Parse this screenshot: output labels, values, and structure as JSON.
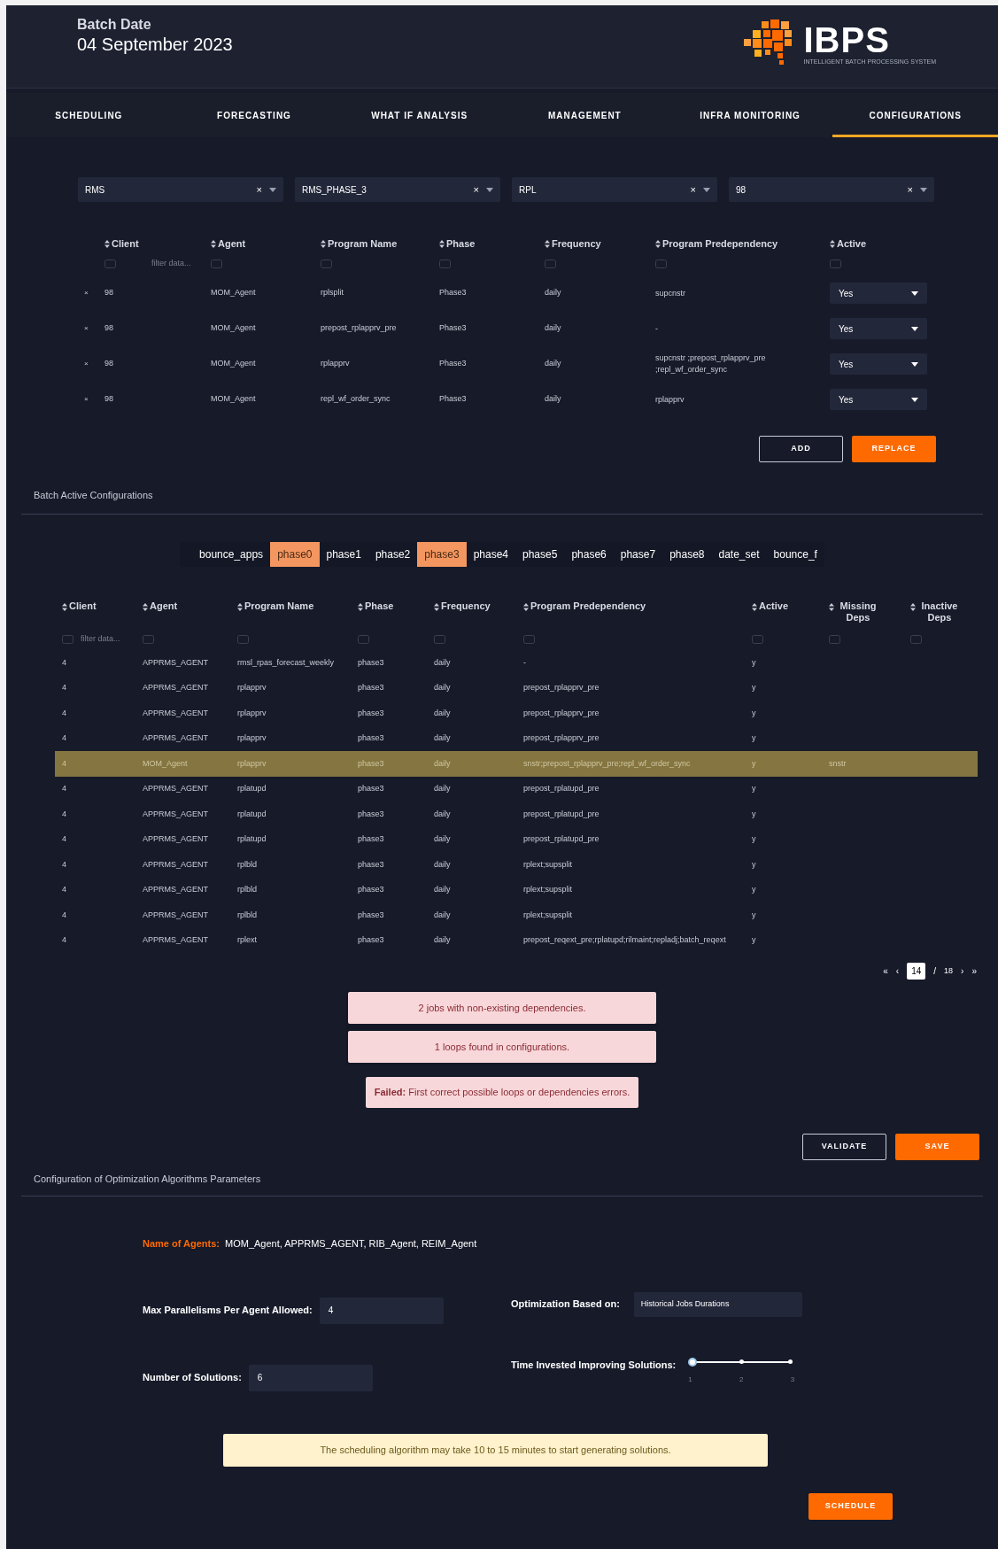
{
  "header": {
    "label": "Batch Date",
    "date": "04 September 2023",
    "logo": {
      "name": "IBPS",
      "tagline": "INTELLIGENT BATCH PROCESSING SYSTEM"
    }
  },
  "tabs": [
    {
      "label": "SCHEDULING",
      "selected": false
    },
    {
      "label": "FORECASTING",
      "selected": false
    },
    {
      "label": "WHAT IF ANALYSIS",
      "selected": false
    },
    {
      "label": "MANAGEMENT",
      "selected": false
    },
    {
      "label": "INFRA MONITORING",
      "selected": false
    },
    {
      "label": "CONFIGURATIONS",
      "selected": true
    }
  ],
  "filters": [
    {
      "value": "RMS",
      "clear": "×"
    },
    {
      "value": "RMS_PHASE_3",
      "clear": "×"
    },
    {
      "value": "RPL",
      "clear": "×"
    },
    {
      "value": "98",
      "clear": "×"
    }
  ],
  "config_table": {
    "columns": [
      "Client",
      "Agent",
      "Program Name",
      "Phase",
      "Frequency",
      "Program Predependency",
      "Active"
    ],
    "filter_placeholder": "filter data...",
    "rows": [
      {
        "remove": "×",
        "cells": [
          "98",
          "MOM_Agent",
          "rplsplit",
          "Phase3",
          "daily",
          "supcnstr"
        ],
        "active": "Yes"
      },
      {
        "remove": "×",
        "cells": [
          "98",
          "MOM_Agent",
          "prepost_rplapprv_pre",
          "Phase3",
          "daily",
          "-"
        ],
        "active": "Yes"
      },
      {
        "remove": "×",
        "cells": [
          "98",
          "MOM_Agent",
          "rplapprv",
          "Phase3",
          "daily",
          "supcnstr ;prepost_rplapprv_pre ;repl_wf_order_sync"
        ],
        "active": "Yes"
      },
      {
        "remove": "×",
        "cells": [
          "98",
          "MOM_Agent",
          "repl_wf_order_sync",
          "Phase3",
          "daily",
          "rplapprv"
        ],
        "active": "Yes"
      }
    ]
  },
  "config_buttons": [
    {
      "label": "ADD",
      "kind": "outline"
    },
    {
      "label": "REPLACE",
      "kind": "primary"
    }
  ],
  "batch_section": {
    "title": "Batch Active Configurations",
    "phases": [
      {
        "label": "bounce_apps",
        "selected": false
      },
      {
        "label": "phase0",
        "selected": true
      },
      {
        "label": "phase1",
        "selected": false
      },
      {
        "label": "phase2",
        "selected": false
      },
      {
        "label": "phase3",
        "selected": true
      },
      {
        "label": "phase4",
        "selected": false
      },
      {
        "label": "phase5",
        "selected": false
      },
      {
        "label": "phase6",
        "selected": false
      },
      {
        "label": "phase7",
        "selected": false
      },
      {
        "label": "phase8",
        "selected": false
      },
      {
        "label": "date_set",
        "selected": false
      },
      {
        "label": "bounce_f",
        "selected": false
      }
    ],
    "table": {
      "columns": [
        "Client",
        "Agent",
        "Program Name",
        "Phase",
        "Frequency",
        "Program Predependency",
        "Active",
        "Missing Deps",
        "Inactive Deps"
      ],
      "filter_placeholder": "filter data...",
      "rows": [
        {
          "highlighted": false,
          "cells": [
            "4",
            "APPRMS_AGENT",
            "rmsl_rpas_forecast_weekly",
            "phase3",
            "daily",
            "-",
            "y",
            "",
            ""
          ]
        },
        {
          "highlighted": false,
          "cells": [
            "4",
            "APPRMS_AGENT",
            "rplapprv",
            "phase3",
            "daily",
            "prepost_rplapprv_pre",
            "y",
            "",
            ""
          ]
        },
        {
          "highlighted": false,
          "cells": [
            "4",
            "APPRMS_AGENT",
            "rplapprv",
            "phase3",
            "daily",
            "prepost_rplapprv_pre",
            "y",
            "",
            ""
          ]
        },
        {
          "highlighted": false,
          "cells": [
            "4",
            "APPRMS_AGENT",
            "rplapprv",
            "phase3",
            "daily",
            "prepost_rplapprv_pre",
            "y",
            "",
            ""
          ]
        },
        {
          "highlighted": true,
          "cells": [
            "4",
            "MOM_Agent",
            "rplapprv",
            "phase3",
            "daily",
            "snstr;prepost_rplapprv_pre;repl_wf_order_sync",
            "y",
            "snstr",
            ""
          ]
        },
        {
          "highlighted": false,
          "cells": [
            "4",
            "APPRMS_AGENT",
            "rplatupd",
            "phase3",
            "daily",
            "prepost_rplatupd_pre",
            "y",
            "",
            ""
          ]
        },
        {
          "highlighted": false,
          "cells": [
            "4",
            "APPRMS_AGENT",
            "rplatupd",
            "phase3",
            "daily",
            "prepost_rplatupd_pre",
            "y",
            "",
            ""
          ]
        },
        {
          "highlighted": false,
          "cells": [
            "4",
            "APPRMS_AGENT",
            "rplatupd",
            "phase3",
            "daily",
            "prepost_rplatupd_pre",
            "y",
            "",
            ""
          ]
        },
        {
          "highlighted": false,
          "cells": [
            "4",
            "APPRMS_AGENT",
            "rplbld",
            "phase3",
            "daily",
            "rplext;supsplit",
            "y",
            "",
            ""
          ]
        },
        {
          "highlighted": false,
          "cells": [
            "4",
            "APPRMS_AGENT",
            "rplbld",
            "phase3",
            "daily",
            "rplext;supsplit",
            "y",
            "",
            ""
          ]
        },
        {
          "highlighted": false,
          "cells": [
            "4",
            "APPRMS_AGENT",
            "rplbld",
            "phase3",
            "daily",
            "rplext;supsplit",
            "y",
            "",
            ""
          ]
        },
        {
          "highlighted": false,
          "cells": [
            "4",
            "APPRMS_AGENT",
            "rplext",
            "phase3",
            "daily",
            "prepost_reqext_pre;rplatupd;rilmaint;repladj;batch_reqext",
            "y",
            "",
            ""
          ]
        }
      ]
    },
    "pagination": {
      "first": "«",
      "prev": "‹",
      "page": "14",
      "separator": "/",
      "total": "18",
      "next": "›",
      "last": "»"
    },
    "alerts": [
      {
        "kind": "error",
        "text": "2 jobs with non-existing dependencies."
      },
      {
        "kind": "error",
        "text": "1 loops found in configurations."
      }
    ],
    "result": {
      "kind": "failed",
      "text": "**Failed:** First correct possible loops or dependencies errors."
    },
    "buttons": [
      {
        "label": "VALIDATE",
        "kind": "outline"
      },
      {
        "label": "SAVE",
        "kind": "primary"
      }
    ]
  },
  "optimization": {
    "title": "Configuration of Optimization Algorithms Parameters",
    "agents_label": "Name of Agents:",
    "agents": "MOM_Agent, APPRMS_AGENT, RIB_Agent, REIM_Agent",
    "max_parallelisms": {
      "label": "Max Parallelisms Per Agent Allowed:",
      "value": "4"
    },
    "based_on": {
      "label": "Optimization Based on:",
      "value": "Historical Jobs Durations"
    },
    "solutions": {
      "label": "Number of Solutions:",
      "value": "6"
    },
    "time_invested": {
      "label": "Time Invested Improving Solutions:",
      "level": 0,
      "ticks": [
        "1",
        "2",
        "3"
      ]
    },
    "note": "The scheduling algorithm may take 10 to 15 minutes to start generating solutions.",
    "button": {
      "label": "SCHEDULE",
      "kind": "primary"
    }
  }
}
